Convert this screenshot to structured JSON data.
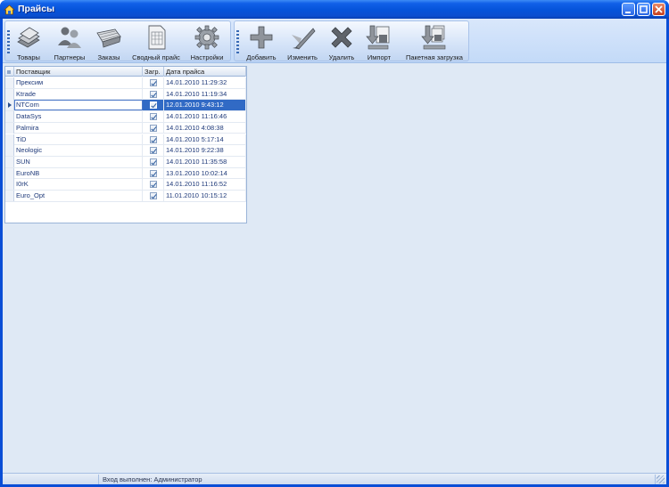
{
  "window": {
    "title": "Прайсы"
  },
  "toolbar_main": [
    {
      "label": "Товары",
      "icon": "books-icon"
    },
    {
      "label": "Партнеры",
      "icon": "people-icon"
    },
    {
      "label": "Заказы",
      "icon": "cart-icon"
    },
    {
      "label": "Сводный прайс",
      "icon": "document-table-icon"
    },
    {
      "label": "Настройки",
      "icon": "gear-icon"
    }
  ],
  "toolbar_edit": [
    {
      "label": "Добавить",
      "icon": "plus-icon"
    },
    {
      "label": "Изменить",
      "icon": "pencil-icon"
    },
    {
      "label": "Удалить",
      "icon": "delete-x-icon"
    },
    {
      "label": "Импорт",
      "icon": "import-icon"
    },
    {
      "label": "Пакетная загрузка",
      "icon": "batch-import-icon"
    }
  ],
  "grid": {
    "columns": [
      "Поставщик",
      "Загр.",
      "Дата прайса"
    ],
    "rows": [
      {
        "supplier": "Прексим",
        "loaded": true,
        "date": "14.01.2010 11:29:32"
      },
      {
        "supplier": "Ktrade",
        "loaded": true,
        "date": "14.01.2010 11:19:34"
      },
      {
        "supplier": "NTCom",
        "loaded": true,
        "date": "12.01.2010 9:43:12"
      },
      {
        "supplier": "DataSys",
        "loaded": true,
        "date": "14.01.2010 11:16:46"
      },
      {
        "supplier": "Palmira",
        "loaded": true,
        "date": "14.01.2010 4:08:38"
      },
      {
        "supplier": "TiD",
        "loaded": true,
        "date": "14.01.2010 5:17:14"
      },
      {
        "supplier": "Neologic",
        "loaded": true,
        "date": "14.01.2010 9:22:38"
      },
      {
        "supplier": "SUN",
        "loaded": true,
        "date": "14.01.2010 11:35:58"
      },
      {
        "supplier": "EuroNB",
        "loaded": true,
        "date": "13.01.2010 10:02:14"
      },
      {
        "supplier": "I0rK",
        "loaded": true,
        "date": "14.01.2010 11:16:52"
      },
      {
        "supplier": "Euro_Opt",
        "loaded": true,
        "date": "11.01.2010 10:15:12"
      }
    ],
    "selected_row": 2
  },
  "status": {
    "login": "Вход выполнен: Администратор"
  },
  "colors": {
    "title_blue": "#0553d9",
    "selection": "#316ac5",
    "client_bg": "#dfe9f5"
  }
}
